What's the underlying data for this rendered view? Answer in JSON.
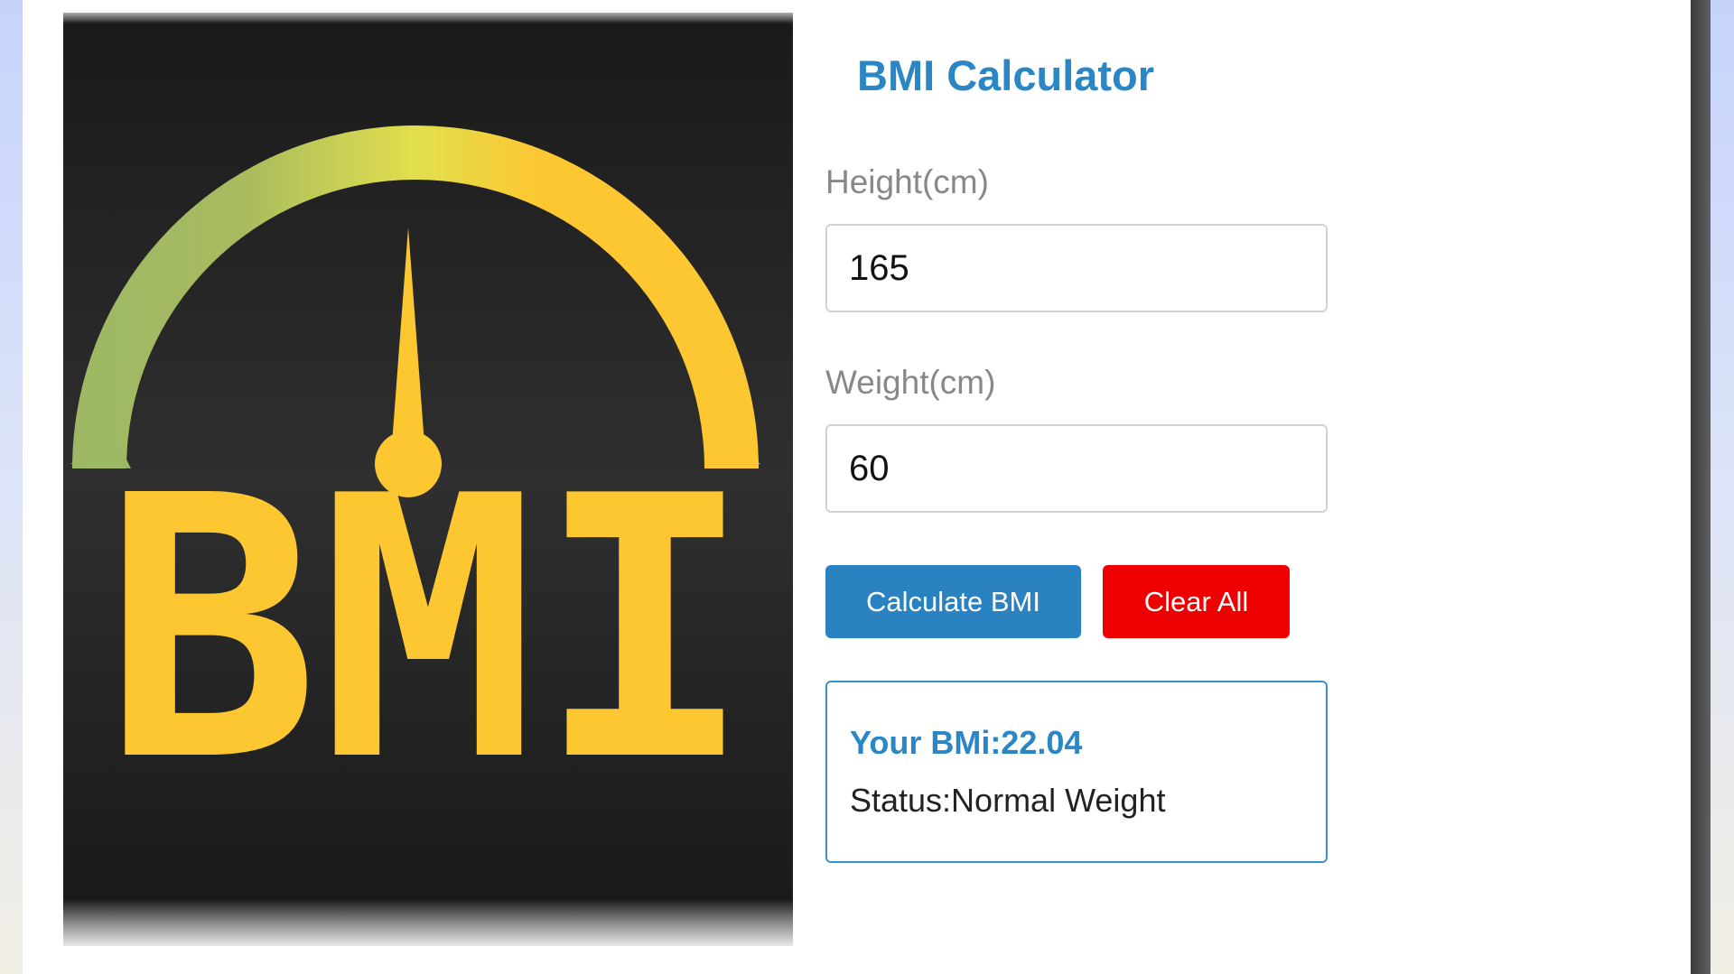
{
  "app": {
    "title": "BMI Calculator"
  },
  "logo": {
    "text": "BMI",
    "gauge_colors": [
      "#9db865",
      "#e2df4e",
      "#fdc732"
    ],
    "text_color": "#fdc732",
    "background": "#1e1e1e",
    "needle_value": 0.5
  },
  "form": {
    "height_label": "Height(cm)",
    "height_value": "165",
    "weight_label": "Weight(cm)",
    "weight_value": "60"
  },
  "buttons": {
    "calculate_label": "Calculate BMI",
    "clear_label": "Clear All"
  },
  "result": {
    "bmi_text": "Your BMi:22.04",
    "status_text": "Status:Normal Weight"
  },
  "colors": {
    "accent": "#2b86c5",
    "calculate_button": "#2b82c0",
    "clear_button": "#ee0000",
    "result_border": "#3a90cf"
  }
}
